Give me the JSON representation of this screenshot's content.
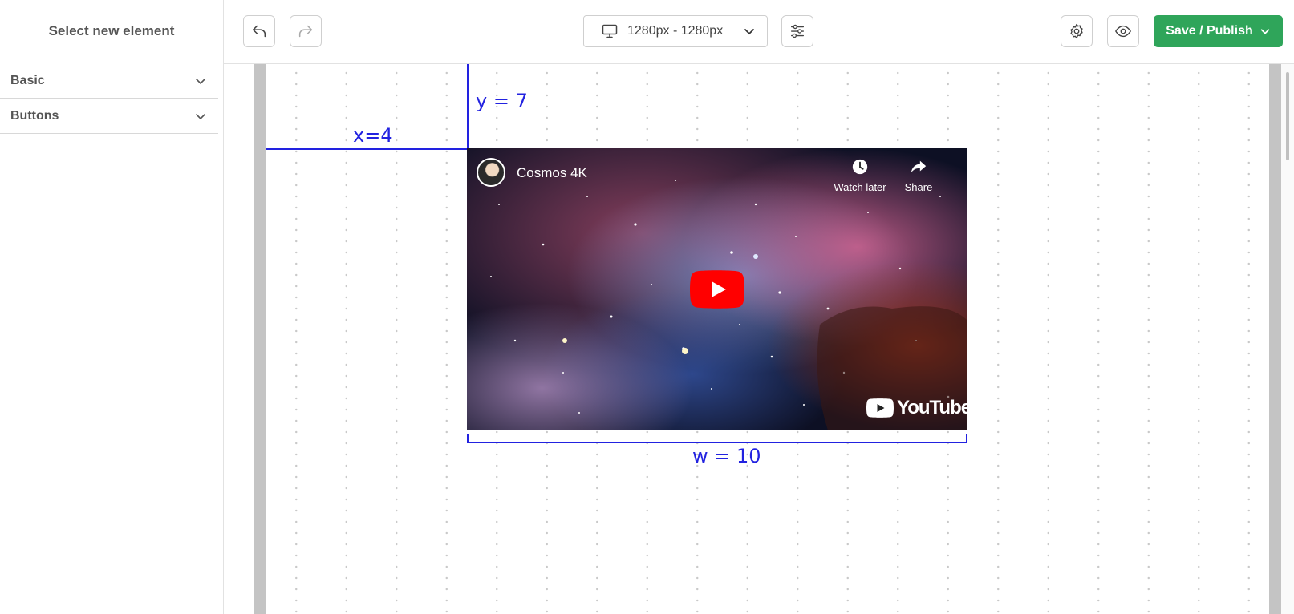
{
  "sidebar": {
    "title": "Select new element",
    "sections": [
      {
        "label": "Basic"
      },
      {
        "label": "Buttons"
      }
    ]
  },
  "toolbar": {
    "device_label": "1280px - 1280px",
    "publish_label": "Save / Publish"
  },
  "canvas": {
    "guides": {
      "x_label": "x=4",
      "y_label": "y = 7",
      "w_label": "w = 10"
    },
    "video": {
      "title": "Cosmos 4K",
      "watch_later": "Watch later",
      "share": "Share",
      "brand": "YouTube"
    }
  },
  "colors": {
    "publish": "#2fa55a",
    "guide": "#2222e0",
    "play": "#ff0000"
  }
}
